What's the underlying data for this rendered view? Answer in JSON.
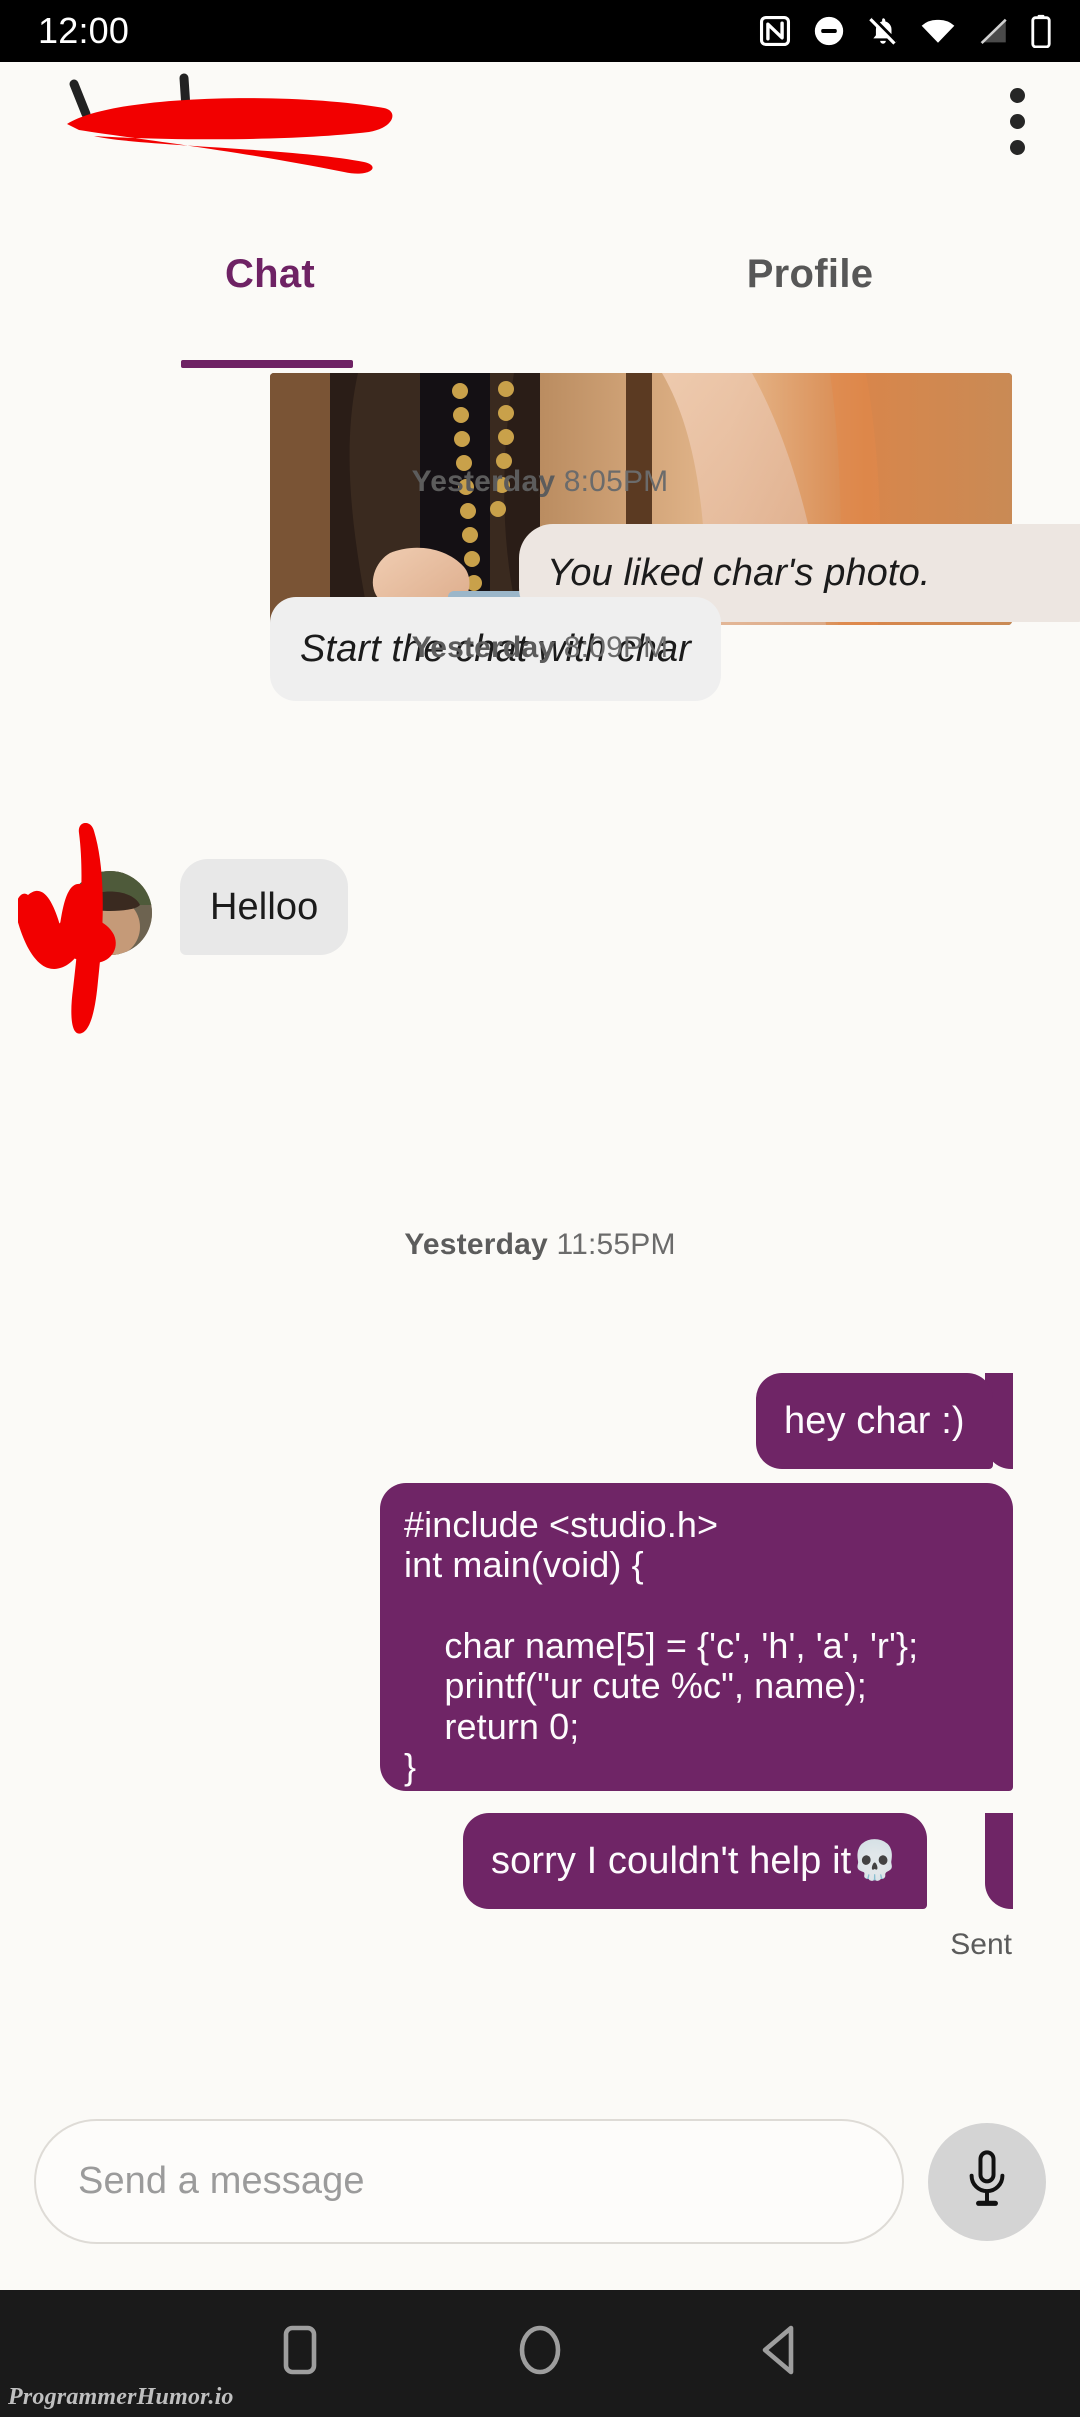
{
  "status_bar": {
    "time": "12:00",
    "icons": [
      "nfc-icon",
      "do-not-disturb-icon",
      "notifications-off-icon",
      "wifi-icon",
      "signal-off-icon",
      "battery-icon"
    ]
  },
  "app_bar": {
    "title": "",
    "title_redacted": true,
    "overflow_menu": "more-options"
  },
  "tabs": {
    "active": "Chat",
    "items": [
      {
        "label": "Chat",
        "active": true
      },
      {
        "label": "Profile",
        "active": false
      }
    ]
  },
  "chat": {
    "photo_caption": "You liked char's photo.",
    "timestamps": {
      "t1": {
        "day": "Yesterday",
        "time": "8:05PM"
      },
      "t2": {
        "day": "Yesterday",
        "time": "8:09PM"
      },
      "t3": {
        "day": "Yesterday",
        "time": "11:55PM"
      }
    },
    "messages": {
      "system_prompt": "Start the chat with char",
      "incoming_hello": "Helloo",
      "out_hey": "hey char :)",
      "out_code": "#include <studio.h>\nint main(void) {\n\n    char name[5] = {'c', 'h', 'a', 'r'};\n    printf(\"ur cute %c\", name);\n    return 0;\n}",
      "out_sorry": "sorry I couldn't help it💀"
    },
    "delivery_status": "Sent"
  },
  "composer": {
    "placeholder": "Send a message",
    "mic_button": "voice-message"
  },
  "nav_bar": {
    "recents": "recents-button",
    "home": "home-button",
    "back": "back-button"
  },
  "watermark": "ProgrammerHumor.io",
  "colors": {
    "accent_purple": "#6F2566",
    "background": "#FBFAF7",
    "incoming_bubble": "#E8E8E8",
    "caption_bubble": "#EDE6E1",
    "redaction_red": "#F20000"
  }
}
